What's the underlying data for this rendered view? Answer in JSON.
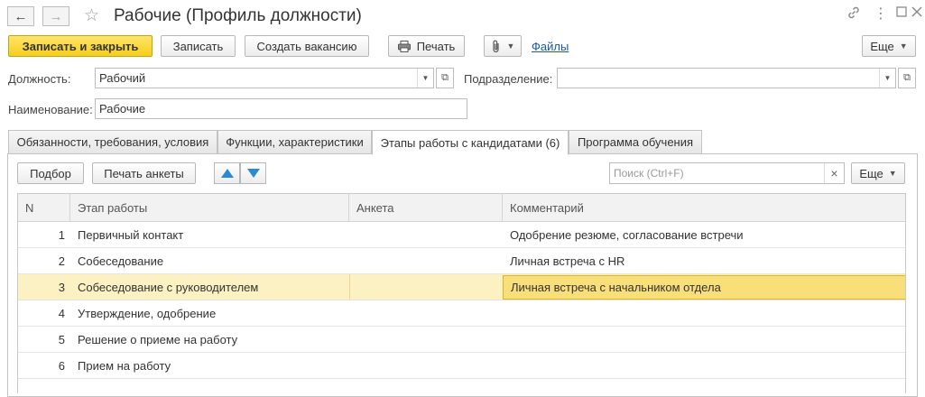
{
  "window": {
    "title": "Рабочие (Профиль должности)"
  },
  "icons": {
    "back": "arrow-left-icon",
    "forward": "arrow-right-icon",
    "favorite": "star-icon",
    "link": "link-icon",
    "menu": "more-vertical-icon",
    "maximize": "maximize-icon",
    "close": "close-icon",
    "print": "printer-icon",
    "attach": "paperclip-icon",
    "move_up": "arrow-up-icon",
    "move_down": "arrow-down-icon",
    "clear": "clear-x-icon"
  },
  "toolbar": {
    "save_close": "Записать и закрыть",
    "save": "Записать",
    "create_vacancy": "Создать вакансию",
    "print": "Печать",
    "files": "Файлы",
    "more": "Еще"
  },
  "form": {
    "position_label": "Должность:",
    "position_value": "Рабочий",
    "department_label": "Подразделение:",
    "department_value": "",
    "name_label": "Наименование:",
    "name_value": "Рабочие"
  },
  "tabs": [
    {
      "label": "Обязанности, требования, условия"
    },
    {
      "label": "Функции, характеристики"
    },
    {
      "label": "Этапы работы с кандидатами (6)"
    },
    {
      "label": "Программа обучения"
    }
  ],
  "active_tab": 2,
  "stages_toolbar": {
    "pick": "Подбор",
    "print_form": "Печать анкеты",
    "search_placeholder": "Поиск (Ctrl+F)",
    "clear": "×",
    "more": "Еще"
  },
  "table": {
    "columns": [
      "N",
      "Этап работы",
      "Анкета",
      "Комментарий"
    ],
    "rows": [
      {
        "n": "1",
        "stage": "Первичный контакт",
        "form": "",
        "comment": "Одобрение резюме, согласование встречи"
      },
      {
        "n": "2",
        "stage": "Собеседование",
        "form": "",
        "comment": "Личная встреча с HR"
      },
      {
        "n": "3",
        "stage": "Собеседование с руководителем",
        "form": "",
        "comment": "Личная встреча с начальником отдела"
      },
      {
        "n": "4",
        "stage": "Утверждение, одобрение",
        "form": "",
        "comment": ""
      },
      {
        "n": "5",
        "stage": "Решение о приеме на работу",
        "form": "",
        "comment": ""
      },
      {
        "n": "6",
        "stage": "Прием на работу",
        "form": "",
        "comment": ""
      }
    ],
    "selected_row": 3
  },
  "colors": {
    "primary_button": "#f5cf1c",
    "selected_row": "#fbf1c2",
    "focused_cell": "#f9df7a",
    "link": "#1a56a8",
    "arrow": "#2b8ad6"
  }
}
